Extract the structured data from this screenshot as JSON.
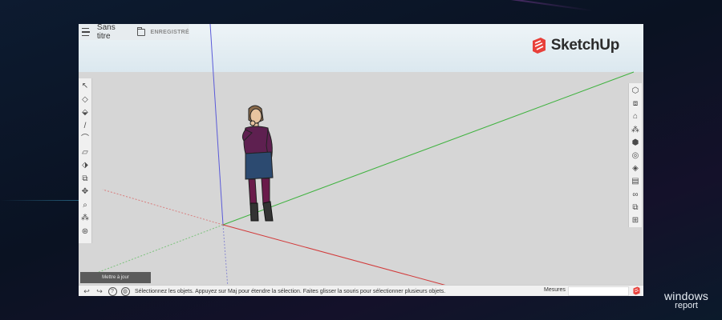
{
  "app": {
    "document_title": "Sans titre",
    "save_status": "ENREGISTRÉ",
    "logo_text": "SketchUp",
    "brand_color": "#e8403a"
  },
  "left_toolbar": {
    "tools": [
      {
        "name": "select-icon",
        "glyph": "↖"
      },
      {
        "name": "eraser-icon",
        "glyph": "◇"
      },
      {
        "name": "paint-bucket-icon",
        "glyph": "⬙"
      },
      {
        "name": "line-icon",
        "glyph": "/"
      },
      {
        "name": "arc-icon",
        "glyph": "⌒"
      },
      {
        "name": "rectangle-icon",
        "glyph": "▱"
      },
      {
        "name": "push-pull-icon",
        "glyph": "⬗"
      },
      {
        "name": "offset-icon",
        "glyph": "⧉"
      },
      {
        "name": "move-icon",
        "glyph": "✥"
      },
      {
        "name": "tape-measure-icon",
        "glyph": "⌕"
      },
      {
        "name": "footprints-icon",
        "glyph": "⁂"
      },
      {
        "name": "orbit-icon",
        "glyph": "⊛"
      }
    ]
  },
  "right_toolbar": {
    "tools": [
      {
        "name": "entity-info-icon",
        "glyph": "⬡"
      },
      {
        "name": "components-icon",
        "glyph": "⧈"
      },
      {
        "name": "materials-icon",
        "glyph": "⌂"
      },
      {
        "name": "styles-icon",
        "glyph": "⁂"
      },
      {
        "name": "scenes-icon",
        "glyph": "⬢"
      },
      {
        "name": "shadows-icon",
        "glyph": "◎"
      },
      {
        "name": "tags-icon",
        "glyph": "◈"
      },
      {
        "name": "views-icon",
        "glyph": "▤"
      },
      {
        "name": "display-icon",
        "glyph": "∞"
      },
      {
        "name": "outliner-icon",
        "glyph": "⧉"
      },
      {
        "name": "instructor-icon",
        "glyph": "⊞"
      }
    ]
  },
  "update_button": "Mettre à jour",
  "statusbar": {
    "text": "Sélectionnez les objets. Appuyez sur Maj pour étendre la sélection. Faites glisser la souris pour sélectionner plusieurs objets.",
    "measure_label": "Mesures",
    "measure_value": ""
  },
  "watermark": {
    "line1": "windows",
    "line2": "report"
  }
}
